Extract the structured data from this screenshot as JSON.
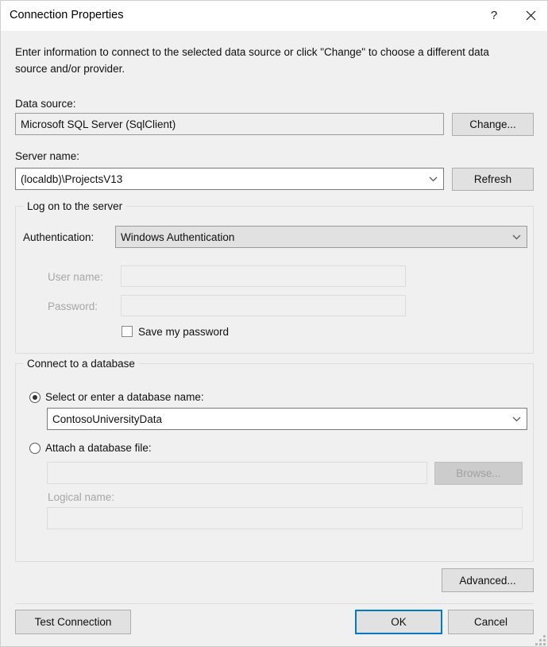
{
  "window": {
    "title": "Connection Properties",
    "help_icon": "question-mark-icon",
    "close_icon": "close-icon"
  },
  "intro": "Enter information to connect to the selected data source or click \"Change\" to choose a different data source and/or provider.",
  "data_source": {
    "label": "Data source:",
    "value": "Microsoft SQL Server (SqlClient)",
    "change_button": "Change..."
  },
  "server": {
    "label": "Server name:",
    "value": "(localdb)\\ProjectsV13",
    "refresh_button": "Refresh"
  },
  "logon": {
    "caption": "Log on to the server",
    "authentication_label": "Authentication:",
    "authentication_value": "Windows Authentication",
    "username_label": "User name:",
    "username_value": "",
    "password_label": "Password:",
    "password_value": "",
    "save_password_label": "Save my password",
    "save_password_checked": false
  },
  "database": {
    "caption": "Connect to a database",
    "select_radio_label": "Select or enter a database name:",
    "select_radio_checked": true,
    "database_name": "ContosoUniversityData",
    "attach_radio_label": "Attach a database file:",
    "attach_radio_checked": false,
    "attach_file_value": "",
    "browse_button": "Browse...",
    "logical_name_label": "Logical name:",
    "logical_name_value": ""
  },
  "footer": {
    "advanced_button": "Advanced...",
    "test_connection_button": "Test Connection",
    "ok_button": "OK",
    "cancel_button": "Cancel"
  },
  "colors": {
    "accent": "#0078d7",
    "dialog_background": "#f0f0f0",
    "button_face": "#e1e1e1"
  }
}
